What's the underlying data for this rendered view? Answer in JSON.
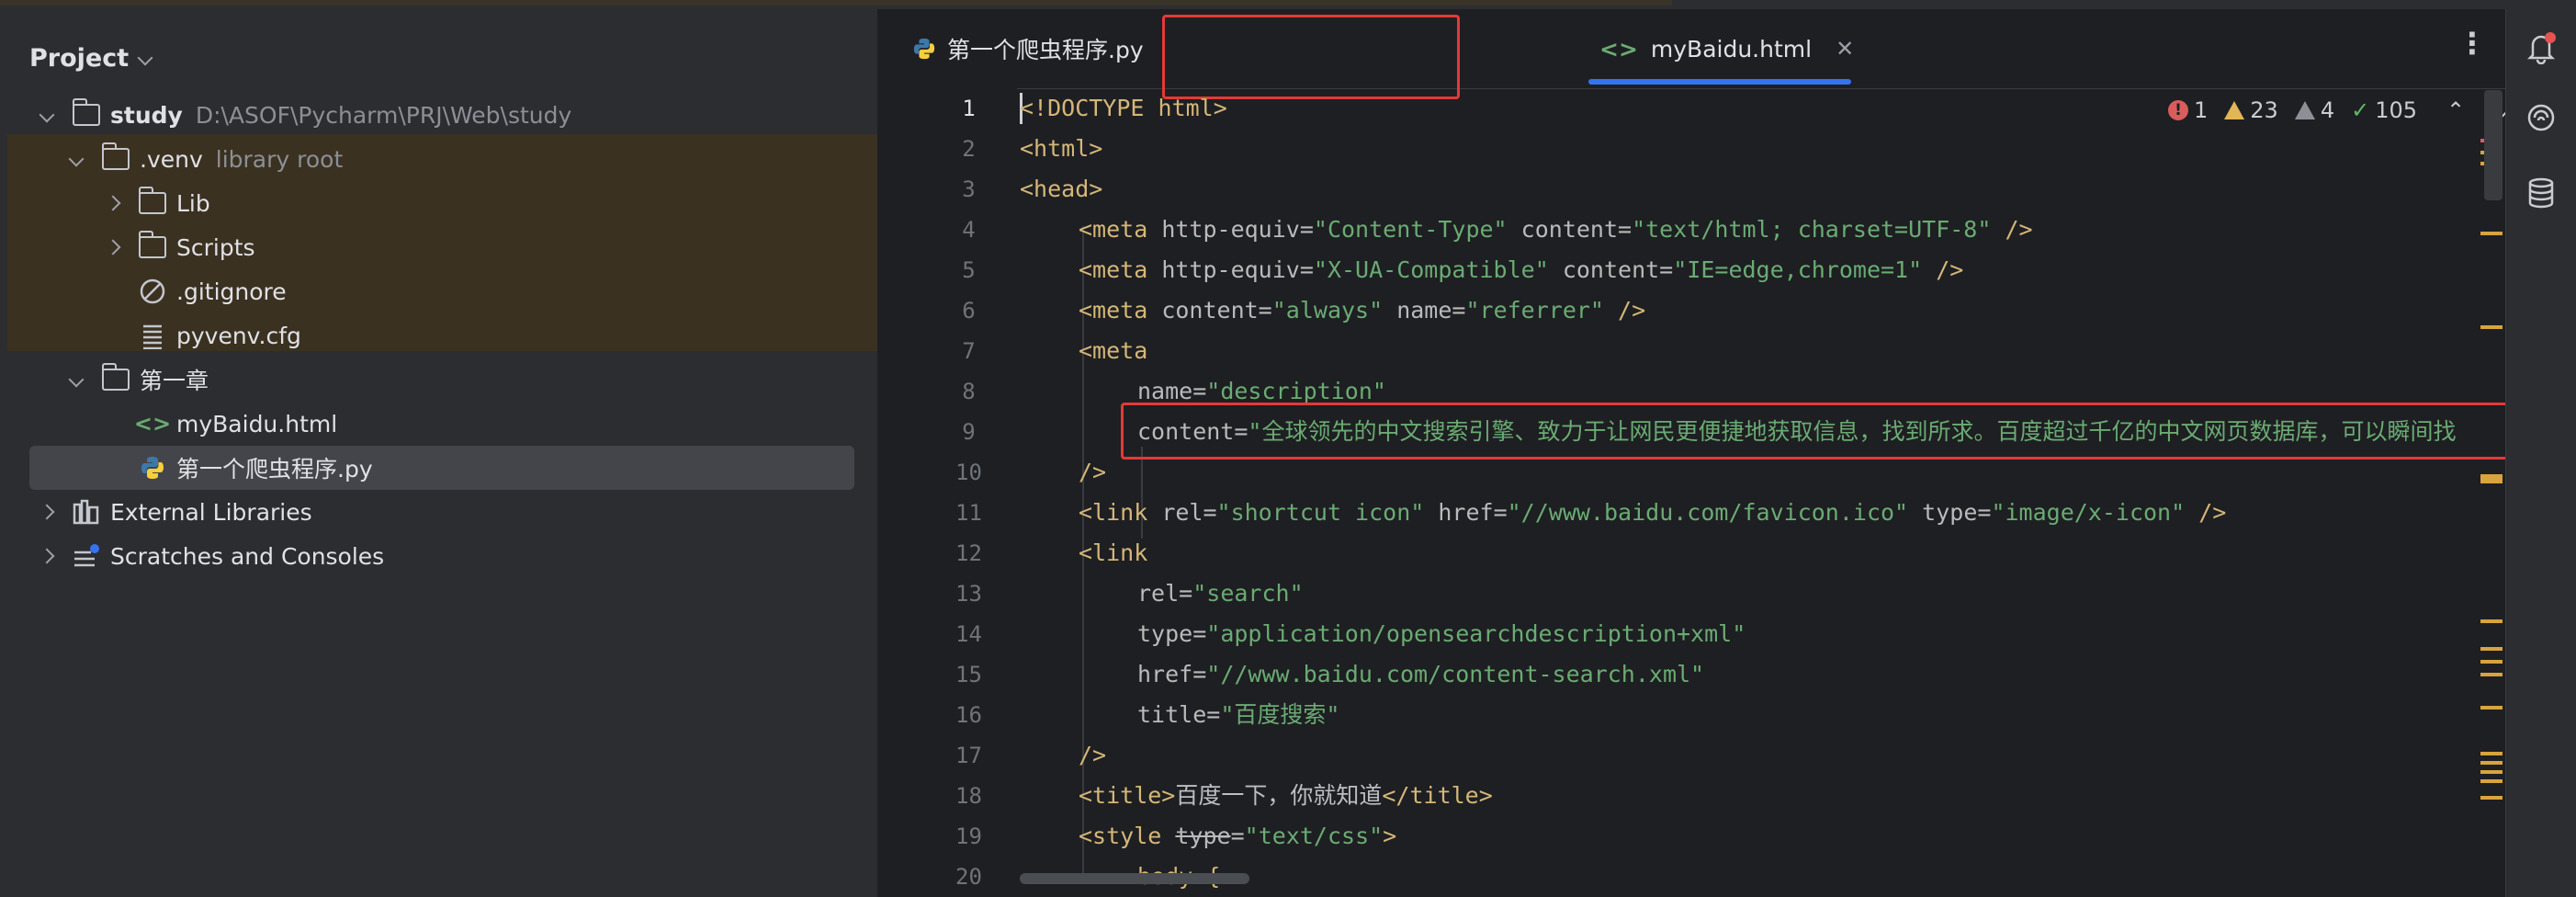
{
  "project": {
    "title": "Project",
    "root_name": "study",
    "root_path": "D:\\ASOF\\Pycharm\\PRJ\\Web\\study",
    "venv_name": ".venv",
    "venv_hint": "library root",
    "lib": "Lib",
    "scripts": "Scripts",
    "gitignore": ".gitignore",
    "pyvenv": "pyvenv.cfg",
    "chapter": "第一章",
    "file_html": "myBaidu.html",
    "file_py": "第一个爬虫程序.py",
    "ext_libs": "External Libraries",
    "scratches": "Scratches and Consoles"
  },
  "tabs": [
    {
      "label": "第一个爬虫程序.py"
    },
    {
      "label": "myBaidu.html"
    }
  ],
  "inspections": {
    "errors": "1",
    "warnings": "23",
    "weak": "4",
    "ok": "105"
  },
  "code": {
    "line_numbers": [
      "1",
      "2",
      "3",
      "4",
      "5",
      "6",
      "7",
      "8",
      "9",
      "10",
      "11",
      "12",
      "13",
      "14",
      "15",
      "16",
      "17",
      "18",
      "19",
      "20"
    ],
    "l1": "<!DOCTYPE html>",
    "l2": "<html>",
    "l3": "<head>",
    "l4_tag": "<meta",
    "l4_a1": " http-equiv=",
    "l4_v1": "\"Content-Type\"",
    "l4_a2": " content=",
    "l4_v2": "\"text/html; charset=UTF-8\"",
    "close_slash": " />",
    "l5_a1": " http-equiv=",
    "l5_v1": "\"X-UA-Compatible\"",
    "l5_a2": " content=",
    "l5_v2": "\"IE=edge,chrome=1\"",
    "l6_a1": " content=",
    "l6_v1": "\"always\"",
    "l6_a2": " name=",
    "l6_v2": "\"referrer\"",
    "l7": "<meta",
    "l8_a": "name=",
    "l8_v": "\"description\"",
    "l9_a": "content=",
    "l9_v": "\"全球领先的中文搜索引擎、致力于让网民更便捷地获取信息，找到所求。百度超过千亿的中文网页数据库，可以瞬间找",
    "l10": "/>",
    "l11_tag": "<link",
    "l11_a1": " rel=",
    "l11_v1": "\"shortcut icon\"",
    "l11_a2": " href=",
    "l11_v2": "\"//www.baidu.com/favicon.ico\"",
    "l11_a3": " type=",
    "l11_v3": "\"image/x-icon\"",
    "l12": "<link",
    "l13_a": "rel=",
    "l13_v": "\"search\"",
    "l14_a": "type=",
    "l14_v": "\"application/opensearchdescription+xml\"",
    "l15_a": "href=",
    "l15_v": "\"//www.baidu.com/content-search.xml\"",
    "l16_a": "title=",
    "l16_v": "\"百度搜索\"",
    "l17": "/>",
    "l18_open": "<title>",
    "l18_text": "百度一下，你就知道",
    "l18_close": "</title>",
    "l19_tag": "<style",
    "l19_a": "type",
    "l19_eq": "=",
    "l19_v": "\"text/css\"",
    "l19_end": ">",
    "l20": "body {"
  }
}
